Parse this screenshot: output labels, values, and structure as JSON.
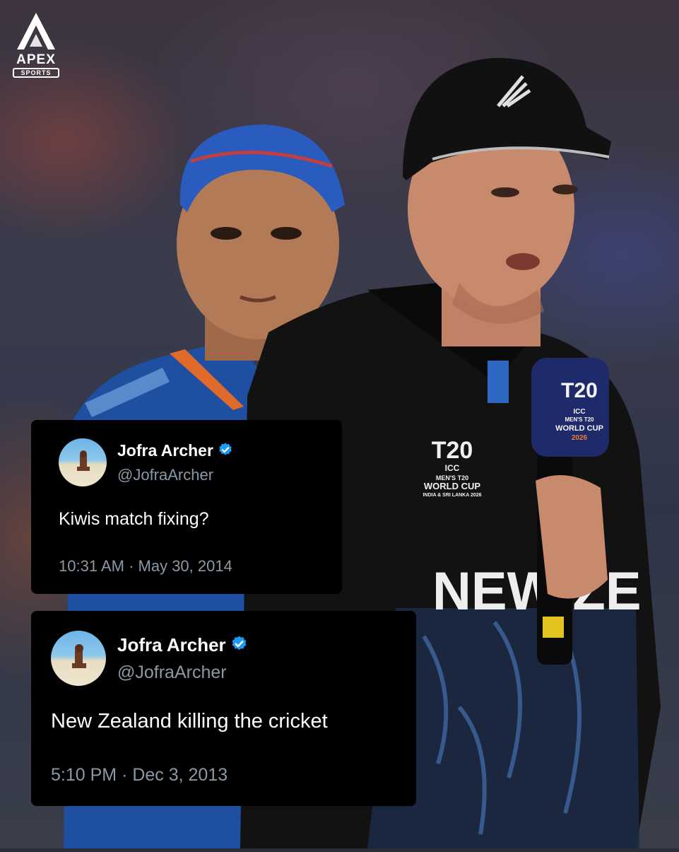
{
  "brand": {
    "name": "APEX",
    "sub": "SPORTS"
  },
  "photo": {
    "jersey_text": "NEW ZE",
    "badge_lines": [
      "ICC",
      "MEN'S T20",
      "WORLD CUP",
      "INDIA & SRI LANKA 2026"
    ],
    "mic_badge_lines": [
      "ICC",
      "MEN'S T20",
      "WORLD CUP",
      "2026"
    ]
  },
  "tweets": [
    {
      "name": "Jofra Archer",
      "handle": "@JofraArcher",
      "text": "Kiwis match fixing?",
      "time": "10:31 AM",
      "date": "May 30, 2014",
      "verified": true
    },
    {
      "name": "Jofra Archer",
      "handle": "@JofraArcher",
      "text": "New Zealand killing the cricket",
      "time": "5:10 PM",
      "date": "Dec 3, 2013",
      "verified": true
    }
  ],
  "colors": {
    "verified_blue": "#1d9bf0",
    "card_bg": "#000000",
    "muted_text": "#8b98a5",
    "nz_black": "#121212",
    "india_blue": "#1f4fa0"
  }
}
